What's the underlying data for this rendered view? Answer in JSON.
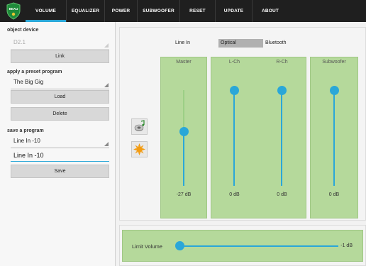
{
  "nav": {
    "logo_text": "BEAU",
    "tabs": [
      {
        "label": "VOLUME",
        "active": true
      },
      {
        "label": "EQUALIZER",
        "active": false
      },
      {
        "label": "POWER",
        "active": false
      },
      {
        "label": "SUBWOOFER",
        "active": false
      },
      {
        "label": "RESET",
        "active": false
      },
      {
        "label": "UPDATE",
        "active": false
      },
      {
        "label": "ABOUT",
        "active": false
      }
    ]
  },
  "left": {
    "object_device_label": "object device",
    "object_device_value": "D2.1",
    "link_button": "Link",
    "preset_label": "apply a preset program",
    "preset_value": "The Big Gig",
    "load_button": "Load",
    "delete_button": "Delete",
    "save_program_label": "save a program",
    "save_program_value": "Line In -10",
    "program_name_input": "Line In -10",
    "save_button": "Save"
  },
  "sources": {
    "items": [
      "Line In",
      "Optical",
      "Bluetooth"
    ],
    "selected": "Optical"
  },
  "icons": {
    "speaker_icon": "speaker-music-icon",
    "sun_icon": "sun-icon"
  },
  "channels": [
    {
      "name": "Master",
      "value": "-27 dB",
      "level": 0.57,
      "active": false
    },
    {
      "name": "L-Ch",
      "value": "0 dB",
      "level": 1.0,
      "active": true
    },
    {
      "name": "R-Ch",
      "value": "0 dB",
      "level": 1.0,
      "active": true
    },
    {
      "name": "Subwoofer",
      "value": "0 dB",
      "level": 1.0,
      "active": true
    }
  ],
  "limit": {
    "label": "Limit Volume",
    "value": "-1 dB",
    "level": 0.0
  },
  "colors": {
    "accent": "#2aa7d8",
    "card_green": "#b5d99b",
    "topbar": "#1f1f1f"
  }
}
